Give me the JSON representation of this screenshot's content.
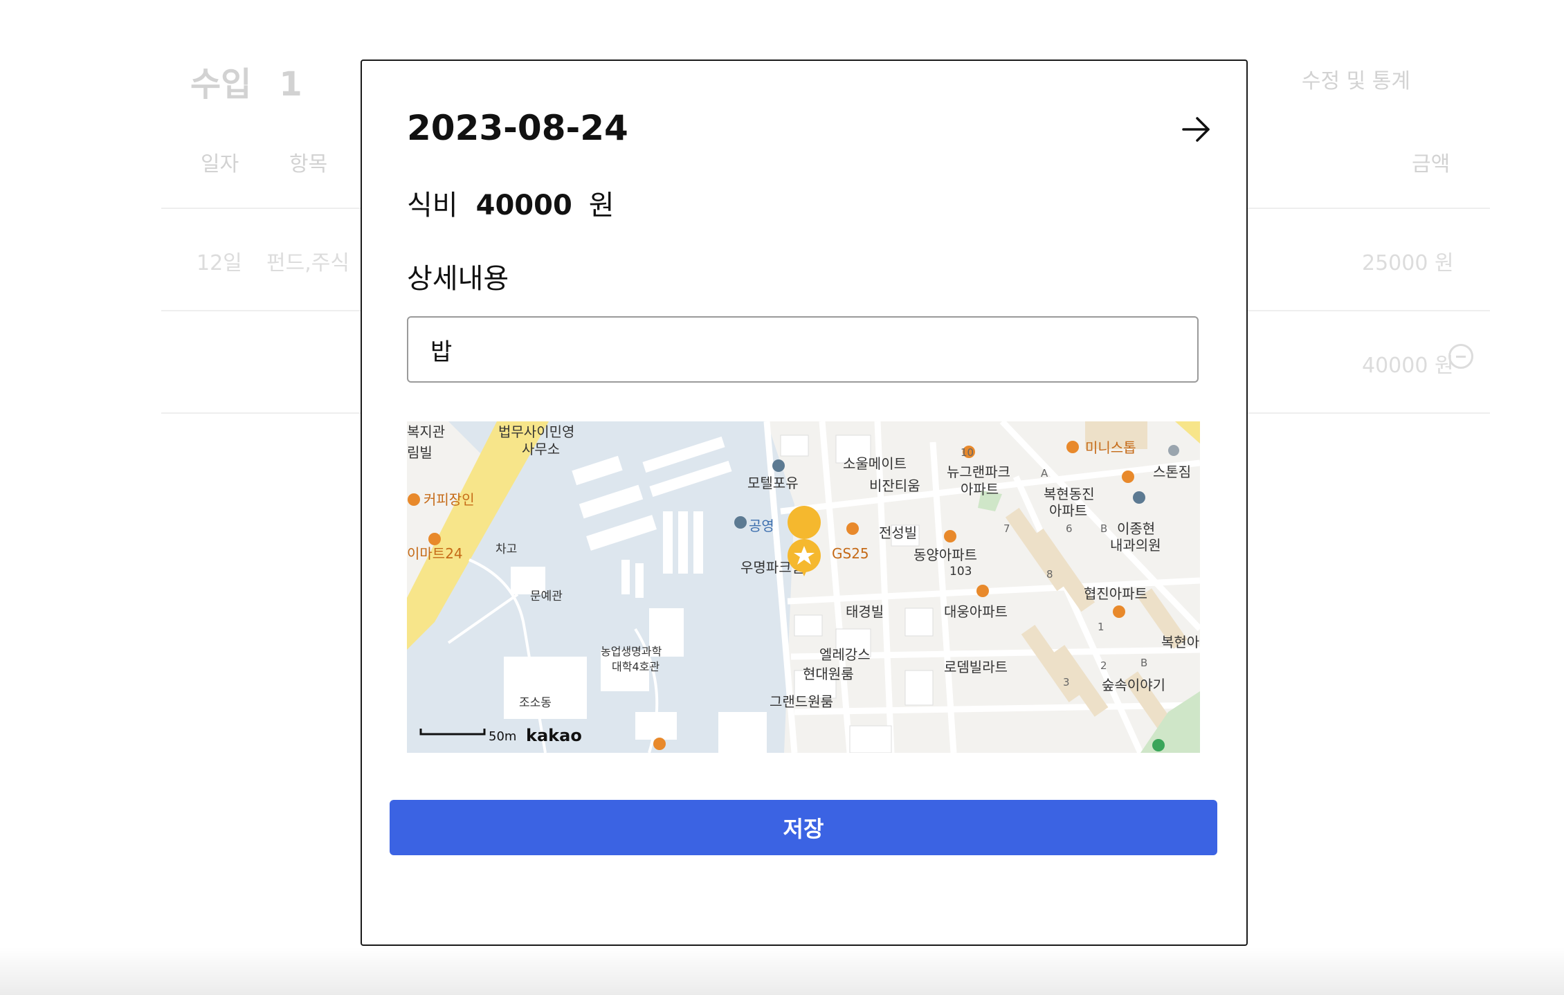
{
  "background": {
    "title": "수입",
    "count": "1",
    "stats_button": "수정 및 통계",
    "headers": {
      "date": "일자",
      "item": "항목",
      "amount": "금액"
    },
    "rows": [
      {
        "date": "12일",
        "item": "펀드,주식",
        "amount": "25000 원"
      },
      {
        "date": "",
        "item": "",
        "amount": "40000 원"
      }
    ]
  },
  "modal": {
    "date": "2023-08-24",
    "category": "식비",
    "amount": "40000",
    "currency": "원",
    "detail_label": "상세내용",
    "detail_value": "밥",
    "save_label": "저장",
    "icons": {
      "next": "arrow-right-icon",
      "marker": "star-marker-icon"
    }
  },
  "map": {
    "provider": "kakao",
    "scale_label": "50m",
    "labels": {
      "l1": "복지관",
      "l2": "법무사이민영",
      "l3": "사무소",
      "l4": "림빌",
      "l5": "커피장인",
      "l6": "이마트24",
      "l7": "차고",
      "l8": "문예관",
      "l9": "농업생명과학",
      "l10": "대학4호관",
      "l11": "조소동",
      "l12": "모텔포유",
      "l13": "소울메이트",
      "l14": "비잔티움",
      "l15": "뉴그랜파크",
      "l16": "아파트",
      "l17": "미니스톱",
      "l18": "스톤짐",
      "l19": "공영",
      "l20": "GS25",
      "l21": "전성빌",
      "l22": "복현동진",
      "l23": "아파트",
      "l24": "이종현",
      "l25": "내과의원",
      "l26": "우명파크빌",
      "l27": "동양아파트",
      "l28": "103",
      "l29": "태경빌",
      "l30": "대웅아파트",
      "l31": "협진아파트",
      "l32": "엘레강스",
      "l33": "현대원룸",
      "l34": "로뎀빌라트",
      "l35": "그랜드원룸",
      "l36": "숲속이야기",
      "l37": "복현아",
      "l38": "10",
      "l39": "A",
      "l40": "B",
      "l41": "6",
      "l42": "7",
      "l43": "8",
      "l44": "1",
      "l45": "2",
      "l46": "3",
      "l47": "B"
    },
    "colors": {
      "land": "#f3f2ef",
      "campus": "#dde6ee",
      "building": "#ffffff",
      "road": "#ffffff",
      "main_road": "#f7e58a",
      "poi": "#e8892b",
      "marker": "#f5b82e",
      "apartment": "#ede0c8"
    }
  },
  "colors": {
    "save_button": "#3b63e3",
    "modal_border": "#1a1a1a"
  }
}
